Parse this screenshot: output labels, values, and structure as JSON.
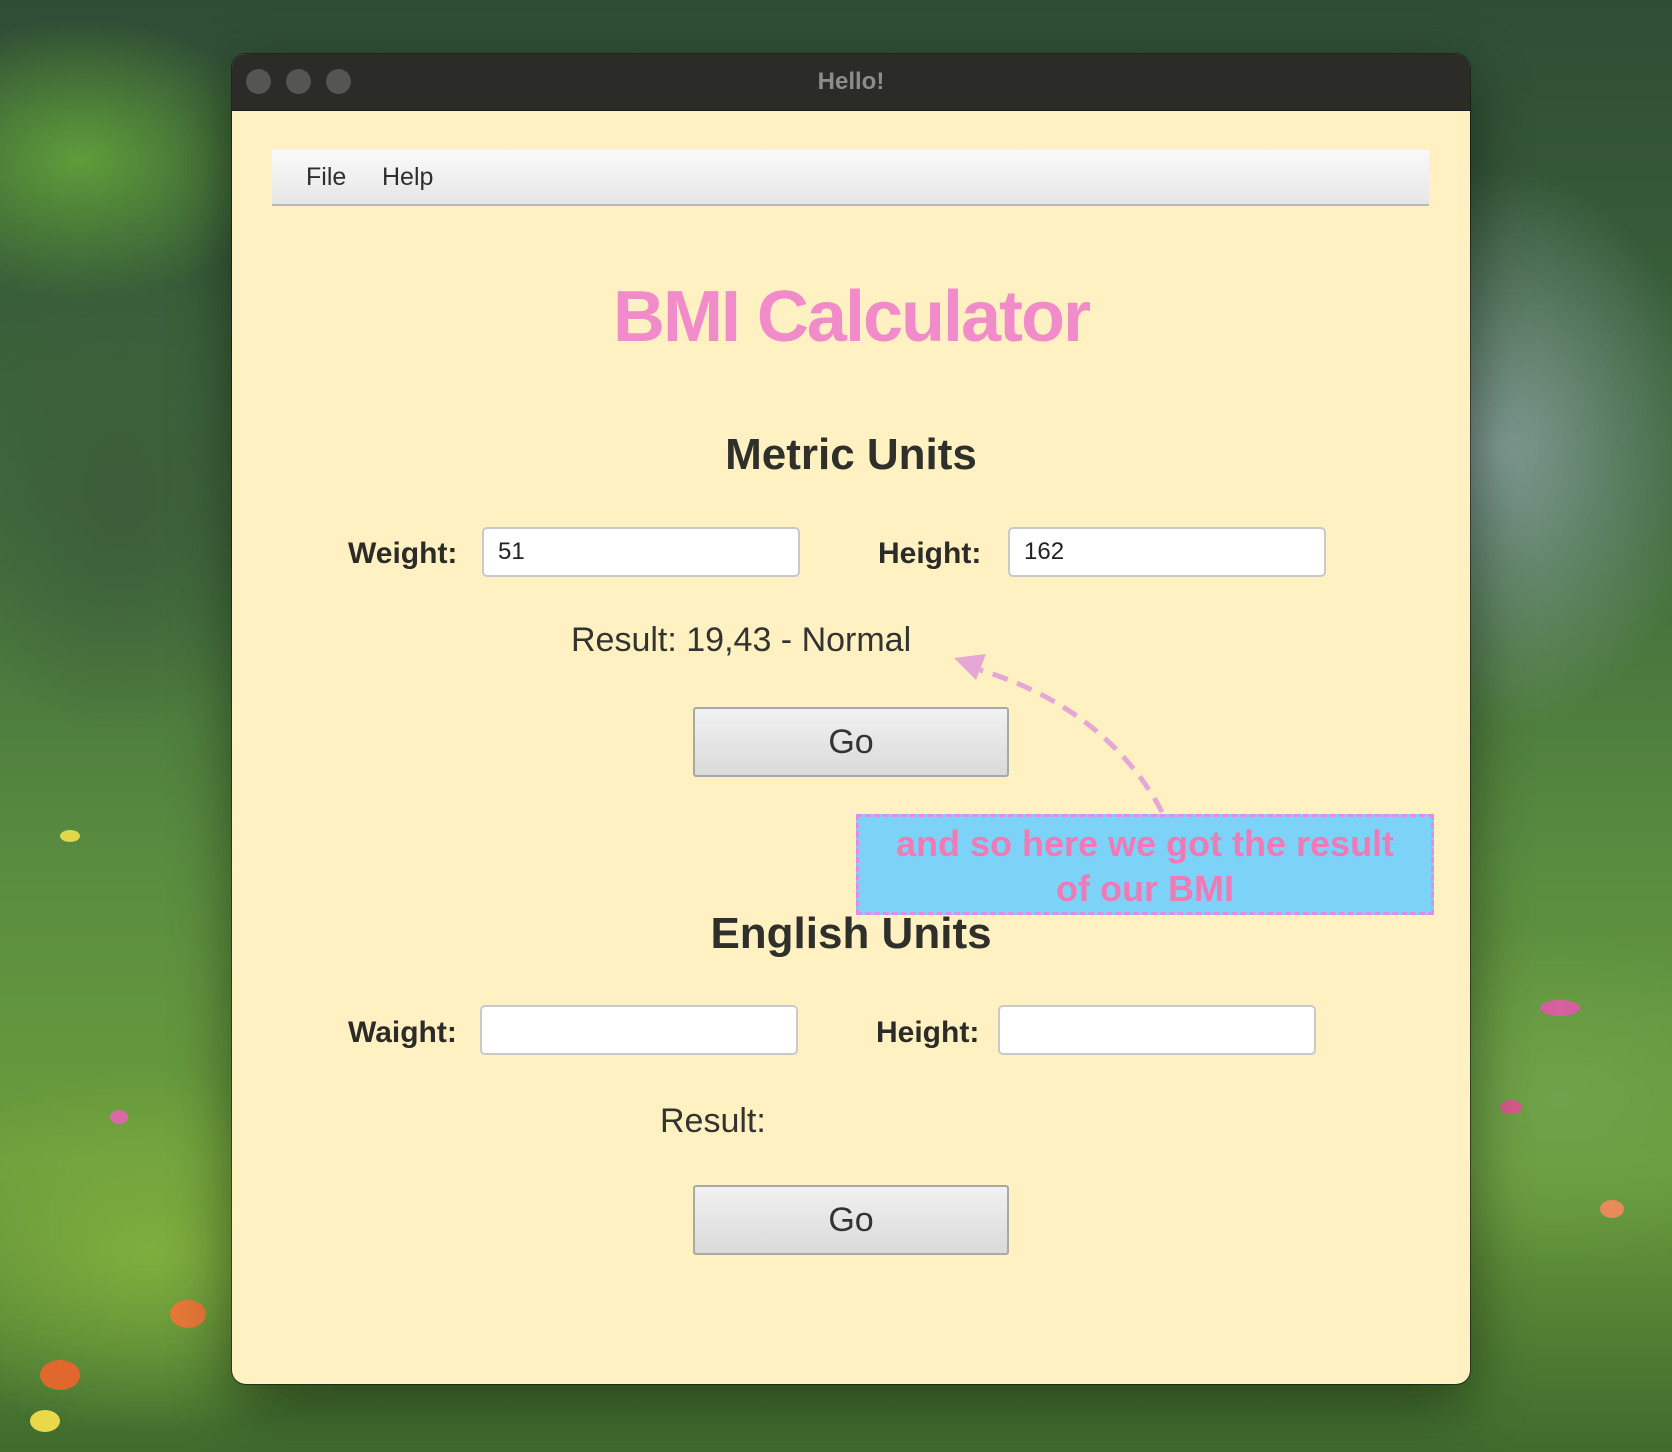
{
  "window": {
    "title": "Hello!"
  },
  "menu": {
    "items": [
      "File",
      "Help"
    ]
  },
  "app": {
    "title": "BMI Calculator"
  },
  "metric": {
    "heading": "Metric Units",
    "weight_label": "Weight:",
    "weight_value": "51",
    "height_label": "Height:",
    "height_value": "162",
    "result_text": "Result: 19,43 - Normal",
    "go_label": "Go"
  },
  "english": {
    "heading": "English Units",
    "weight_label": "Waight:",
    "weight_value": "",
    "height_label": "Height:",
    "height_value": "",
    "result_text": "Result:",
    "go_label": "Go"
  },
  "annotation": {
    "text_line1": "and so here we got the result",
    "text_line2": "of our BMI",
    "box_color": "#7dd3f7",
    "text_color": "#f07ab6",
    "border_color": "#e58ae6"
  },
  "colors": {
    "window_bg": "#fff1c2",
    "title_accent": "#f28bc9",
    "titlebar_bg": "#2b2c28"
  },
  "icons": [
    "close-button",
    "minimize-button",
    "zoom-button",
    "annotation-arrow-icon"
  ]
}
